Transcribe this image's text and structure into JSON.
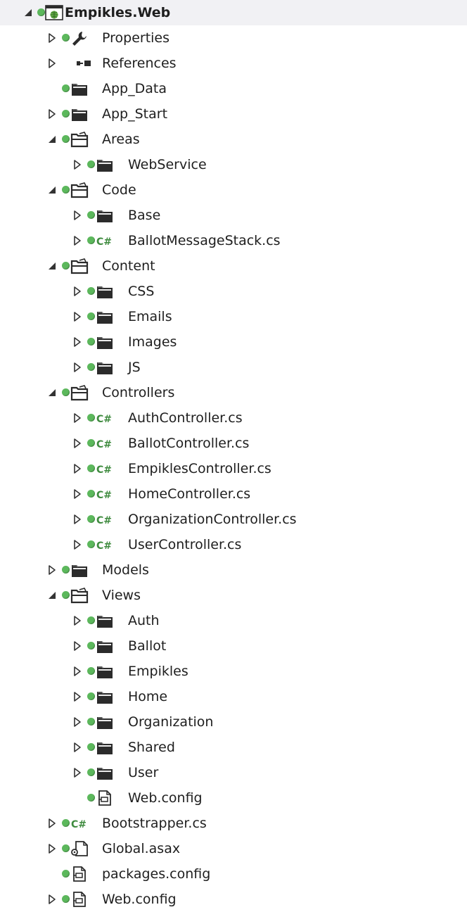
{
  "solution_explorer": {
    "items": [
      {
        "label": "Empikles.Web",
        "depth": 0,
        "expander": "expanded",
        "icon": "web-project-icon",
        "status": true,
        "bold": true
      },
      {
        "label": "Properties",
        "depth": 1,
        "expander": "collapsed",
        "icon": "wrench-icon",
        "status": true
      },
      {
        "label": "References",
        "depth": 1,
        "expander": "collapsed",
        "icon": "references-icon",
        "status": false
      },
      {
        "label": "App_Data",
        "depth": 1,
        "expander": "none",
        "icon": "folder-icon",
        "status": true
      },
      {
        "label": "App_Start",
        "depth": 1,
        "expander": "collapsed",
        "icon": "folder-icon",
        "status": true
      },
      {
        "label": "Areas",
        "depth": 1,
        "expander": "expanded",
        "icon": "folder-open-icon",
        "status": true
      },
      {
        "label": "WebService",
        "depth": 2,
        "expander": "collapsed",
        "icon": "folder-icon",
        "status": true
      },
      {
        "label": "Code",
        "depth": 1,
        "expander": "expanded",
        "icon": "folder-open-icon",
        "status": true
      },
      {
        "label": "Base",
        "depth": 2,
        "expander": "collapsed",
        "icon": "folder-icon",
        "status": true
      },
      {
        "label": "BallotMessageStack.cs",
        "depth": 2,
        "expander": "collapsed",
        "icon": "csharp-file-icon",
        "status": true
      },
      {
        "label": "Content",
        "depth": 1,
        "expander": "expanded",
        "icon": "folder-open-icon",
        "status": true
      },
      {
        "label": "CSS",
        "depth": 2,
        "expander": "collapsed",
        "icon": "folder-icon",
        "status": true
      },
      {
        "label": "Emails",
        "depth": 2,
        "expander": "collapsed",
        "icon": "folder-icon",
        "status": true
      },
      {
        "label": "Images",
        "depth": 2,
        "expander": "collapsed",
        "icon": "folder-icon",
        "status": true
      },
      {
        "label": "JS",
        "depth": 2,
        "expander": "collapsed",
        "icon": "folder-icon",
        "status": true
      },
      {
        "label": "Controllers",
        "depth": 1,
        "expander": "expanded",
        "icon": "folder-open-icon",
        "status": true
      },
      {
        "label": "AuthController.cs",
        "depth": 2,
        "expander": "collapsed",
        "icon": "csharp-file-icon",
        "status": true
      },
      {
        "label": "BallotController.cs",
        "depth": 2,
        "expander": "collapsed",
        "icon": "csharp-file-icon",
        "status": true
      },
      {
        "label": "EmpiklesController.cs",
        "depth": 2,
        "expander": "collapsed",
        "icon": "csharp-file-icon",
        "status": true
      },
      {
        "label": "HomeController.cs",
        "depth": 2,
        "expander": "collapsed",
        "icon": "csharp-file-icon",
        "status": true
      },
      {
        "label": "OrganizationController.cs",
        "depth": 2,
        "expander": "collapsed",
        "icon": "csharp-file-icon",
        "status": true
      },
      {
        "label": "UserController.cs",
        "depth": 2,
        "expander": "collapsed",
        "icon": "csharp-file-icon",
        "status": true
      },
      {
        "label": "Models",
        "depth": 1,
        "expander": "collapsed",
        "icon": "folder-icon",
        "status": true
      },
      {
        "label": "Views",
        "depth": 1,
        "expander": "expanded",
        "icon": "folder-open-icon",
        "status": true
      },
      {
        "label": "Auth",
        "depth": 2,
        "expander": "collapsed",
        "icon": "folder-icon",
        "status": true
      },
      {
        "label": "Ballot",
        "depth": 2,
        "expander": "collapsed",
        "icon": "folder-icon",
        "status": true
      },
      {
        "label": "Empikles",
        "depth": 2,
        "expander": "collapsed",
        "icon": "folder-icon",
        "status": true
      },
      {
        "label": "Home",
        "depth": 2,
        "expander": "collapsed",
        "icon": "folder-icon",
        "status": true
      },
      {
        "label": "Organization",
        "depth": 2,
        "expander": "collapsed",
        "icon": "folder-icon",
        "status": true
      },
      {
        "label": "Shared",
        "depth": 2,
        "expander": "collapsed",
        "icon": "folder-icon",
        "status": true
      },
      {
        "label": "User",
        "depth": 2,
        "expander": "collapsed",
        "icon": "folder-icon",
        "status": true
      },
      {
        "label": "Web.config",
        "depth": 2,
        "expander": "none",
        "icon": "config-file-icon",
        "status": true
      },
      {
        "label": "Bootstrapper.cs",
        "depth": 1,
        "expander": "collapsed",
        "icon": "csharp-file-icon",
        "status": true
      },
      {
        "label": "Global.asax",
        "depth": 1,
        "expander": "collapsed",
        "icon": "asax-file-icon",
        "status": true
      },
      {
        "label": "packages.config",
        "depth": 1,
        "expander": "none",
        "icon": "config-file-icon",
        "status": true
      },
      {
        "label": "Web.config",
        "depth": 1,
        "expander": "collapsed",
        "icon": "config-file-icon",
        "status": true
      }
    ]
  },
  "colors": {
    "status_green": "#5cb85c",
    "csharp_green": "#3f8b3f",
    "text": "#1e1e1e",
    "arrow": "#444444"
  }
}
